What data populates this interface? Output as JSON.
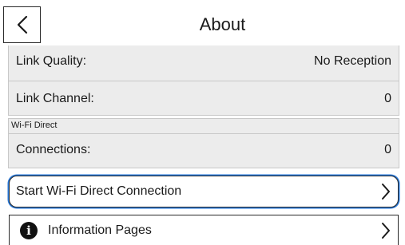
{
  "header": {
    "title": "About",
    "back_icon": "chevron-left-icon"
  },
  "status_rows": [
    {
      "label": "Link Quality:",
      "value": "No Reception"
    },
    {
      "label": "Link Channel:",
      "value": "0"
    }
  ],
  "wifi_direct": {
    "section_label": "Wi-Fi Direct",
    "connections_label": "Connections:",
    "connections_value": "0"
  },
  "buttons": {
    "start_wifi_direct": {
      "label": "Start Wi-Fi Direct Connection",
      "icon": "chevron-right-icon",
      "focused": true,
      "focus_color": "#2878d8"
    },
    "information_pages": {
      "label": "Information Pages",
      "leading_icon": "info-icon",
      "leading_icon_glyph": "i",
      "icon": "chevron-right-icon"
    }
  }
}
